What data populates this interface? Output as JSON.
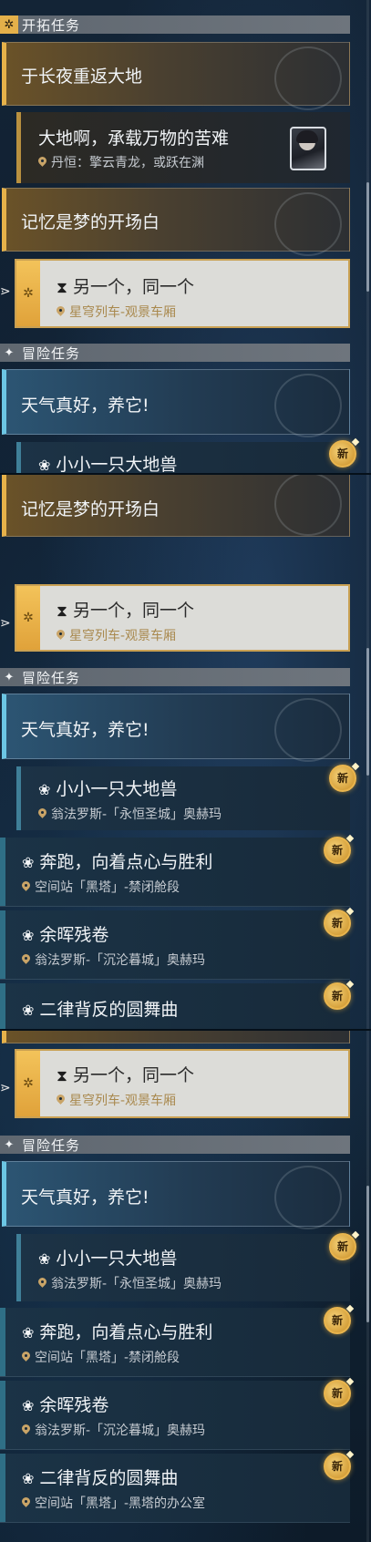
{
  "sections": {
    "trailblaze": "开拓任务",
    "adventure": "冒险任务"
  },
  "icons": {
    "trailblaze_section": "trailblaze-diamond-icon",
    "adventure_section": "four-point-star-icon",
    "tracking": "hourglass-icon",
    "companion": "paw-icon",
    "location": "map-pin-icon",
    "new_badge": "new-badge-icon"
  },
  "quests": {
    "chapter_a": "于长夜重返大地",
    "sub_a": {
      "title": "大地啊，承载万物的苦难",
      "location": "丹恒：擎云青龙，或跃在渊"
    },
    "chapter_b": "记忆是梦的开场白",
    "active": {
      "title": "另一个，同一个",
      "location": "星穹列车-观景车厢"
    },
    "chapter_c": "天气真好，养它!",
    "adv1": {
      "title": "小小一只大地兽",
      "location": "翁法罗斯-「永恒圣城」奥赫玛"
    },
    "adv2": {
      "title": "奔跑，向着点心与胜利",
      "location": "空间站「黑塔」-禁闭舱段"
    },
    "adv3": {
      "title": "余晖残卷",
      "location": "翁法罗斯-「沉沦暮城」奥赫玛"
    },
    "adv4": {
      "title": "二律背反的圆舞曲",
      "location": "空间站「黑塔」-黑塔的办公室"
    }
  },
  "badge_new": "新",
  "colors": {
    "gold": "#e6b24a",
    "blue_accent": "#6cc6e4",
    "badge": "#e9b54e"
  }
}
